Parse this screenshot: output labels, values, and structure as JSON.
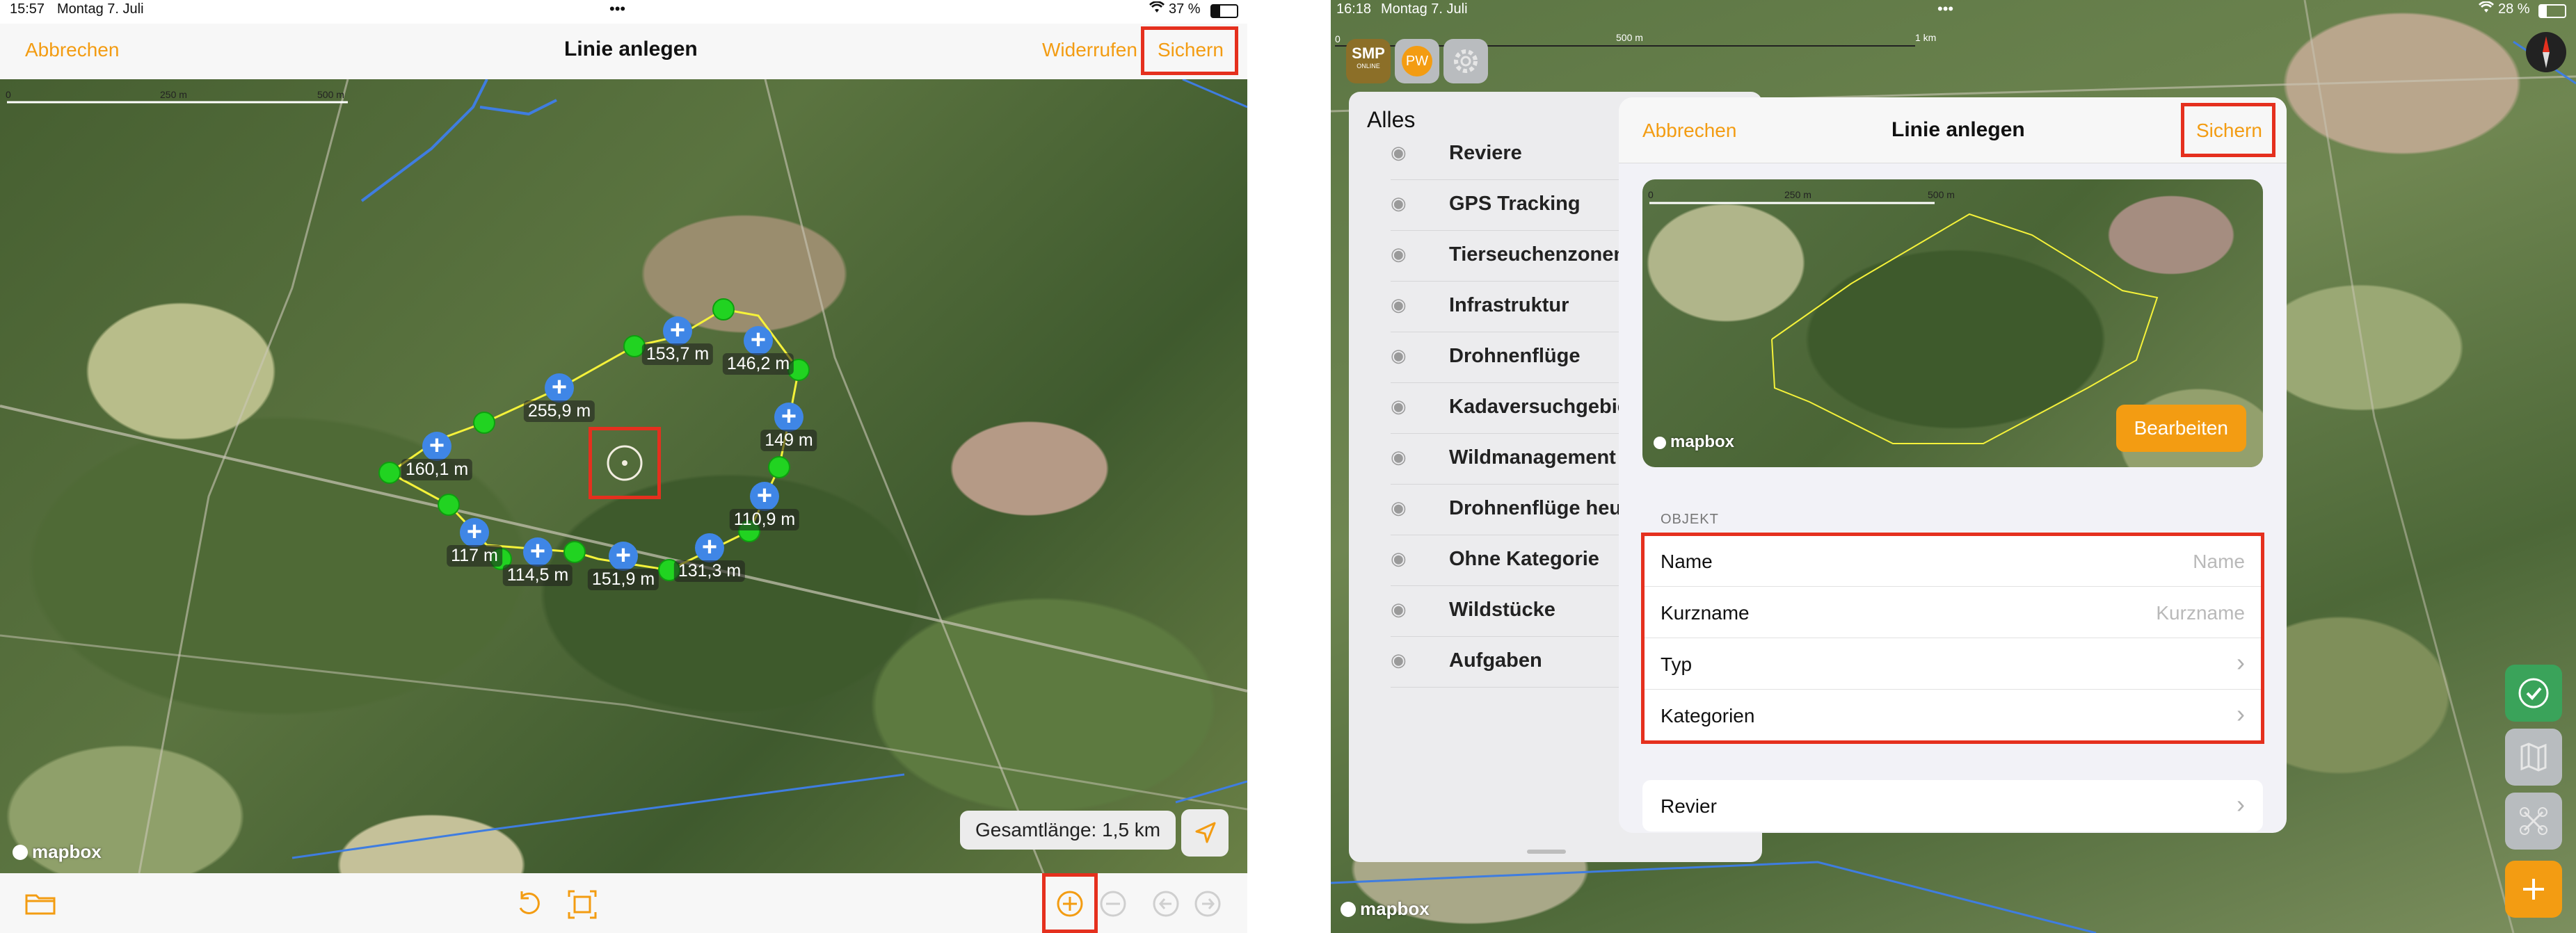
{
  "left": {
    "status": {
      "time": "15:57",
      "date": "Montag 7. Juli",
      "battery": "37 %"
    },
    "nav": {
      "cancel": "Abbrechen",
      "title": "Linie anlegen",
      "undo": "Widerrufen",
      "save": "Sichern"
    },
    "scale": {
      "t0": "0",
      "t1": "250 m",
      "t2": "500 m"
    },
    "segments": [
      "153,7 m",
      "146,2 m",
      "255,9 m",
      "149 m",
      "160,1 m",
      "110,9 m",
      "117 m",
      "114,5 m",
      "151,9 m",
      "131,3 m"
    ],
    "total_length": "Gesamtlänge: 1,5 km",
    "mapbox": "mapbox",
    "colors": {
      "accent": "#f39c12",
      "vertex": "#21d321",
      "node": "#3f86e6",
      "line": "#f5f23a",
      "highlight": "#e5301e"
    }
  },
  "right": {
    "status": {
      "time": "16:18",
      "date": "Montag 7. Juli",
      "battery": "28 %"
    },
    "scale": {
      "t0": "0",
      "t1": "500 m",
      "t2": "1 km"
    },
    "apps": {
      "smp": "SMP",
      "smp_sub": "ONLINE",
      "pw": "PW"
    },
    "sidebar": {
      "title": "Alles",
      "items": [
        "Reviere",
        "GPS Tracking",
        "Tierseuchenzonen",
        "Infrastruktur",
        "Drohnenflüge",
        "Kadaversuchgebiete",
        "Wildmanagement Pun",
        "Drohnenflüge heute",
        "Ohne Kategorie",
        "Wildstücke",
        "Aufgaben"
      ]
    },
    "modal": {
      "cancel": "Abbrechen",
      "title": "Linie anlegen",
      "save": "Sichern",
      "preview_scale": {
        "t0": "0",
        "t1": "250 m",
        "t2": "500 m"
      },
      "edit": "Bearbeiten",
      "section": "OBJEKT",
      "fields": [
        {
          "label": "Name",
          "placeholder": "Name"
        },
        {
          "label": "Kurzname",
          "placeholder": "Kurzname"
        },
        {
          "label": "Typ"
        },
        {
          "label": "Kategorien"
        }
      ],
      "revier": "Revier"
    },
    "mapbox": "mapbox"
  }
}
